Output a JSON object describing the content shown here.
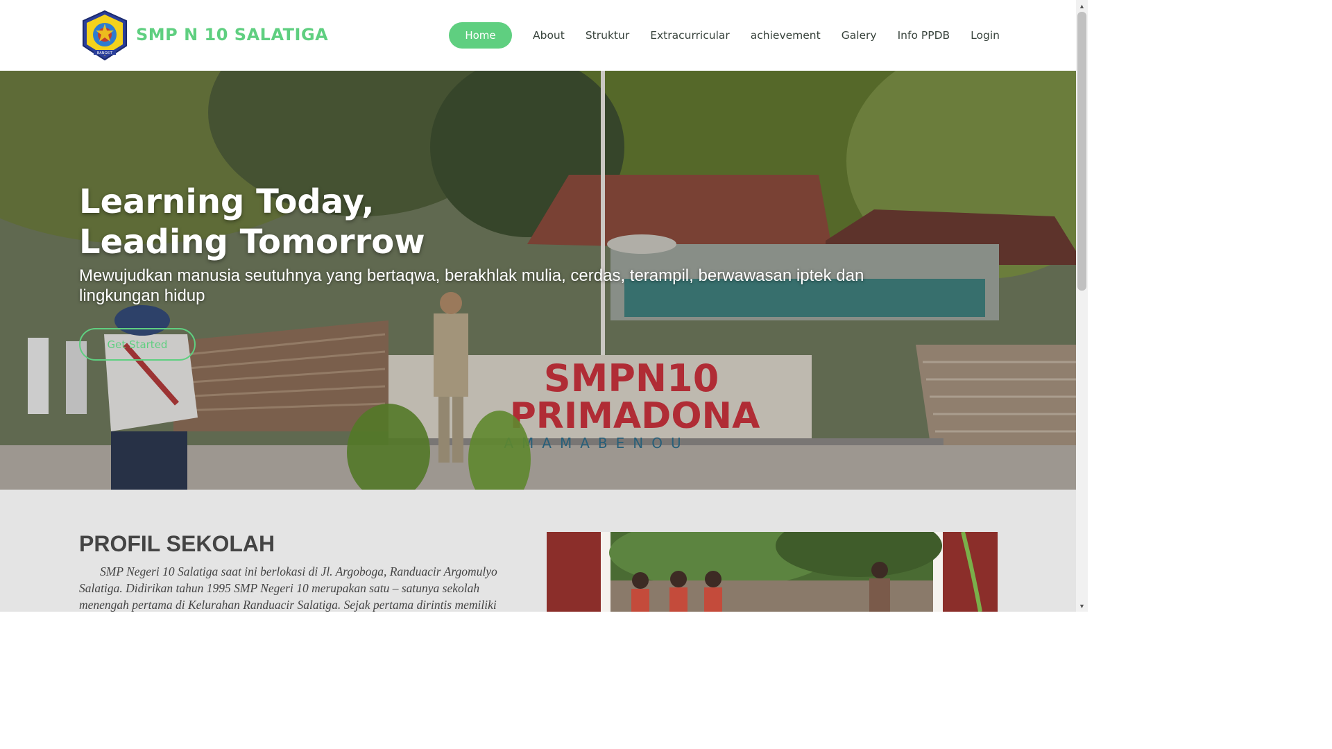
{
  "header": {
    "brand": "SMP N 10 SALATIGA",
    "logo_text": "BANGKIT",
    "nav": [
      {
        "label": "Home",
        "active": true
      },
      {
        "label": "About"
      },
      {
        "label": "Struktur"
      },
      {
        "label": "Extracurricular"
      },
      {
        "label": "achievement"
      },
      {
        "label": "Galery"
      },
      {
        "label": "Info PPDB"
      },
      {
        "label": "Login"
      }
    ]
  },
  "hero": {
    "title_line1": "Learning Today,",
    "title_line2": "Leading Tomorrow",
    "subtitle": "Mewujudkan manusia seutuhnya yang bertaqwa, berakhlak mulia, cerdas, terampil, berwawasan iptek dan lingkungan hidup",
    "button": "Get Started",
    "sign_line1": "SMPN10",
    "sign_line2": "PRIMADONA",
    "sign_line3": "AMAMABENOU"
  },
  "profil": {
    "title": "PROFIL SEKOLAH",
    "text": "SMP Negeri 10 Salatiga saat ini berlokasi di Jl. Argoboga, Randuacir Argomulyo Salatiga. Didirikan tahun 1995 SMP Negeri 10 merupakan satu – satunya sekolah menengah pertama di Kelurahan Randuacir Salatiga. Sejak pertama dirintis memiliki"
  },
  "colors": {
    "accent": "#5fcf80",
    "nav_text": "#37423b",
    "profil_bg": "#e4e4e4",
    "sign_red": "#c9333d"
  }
}
